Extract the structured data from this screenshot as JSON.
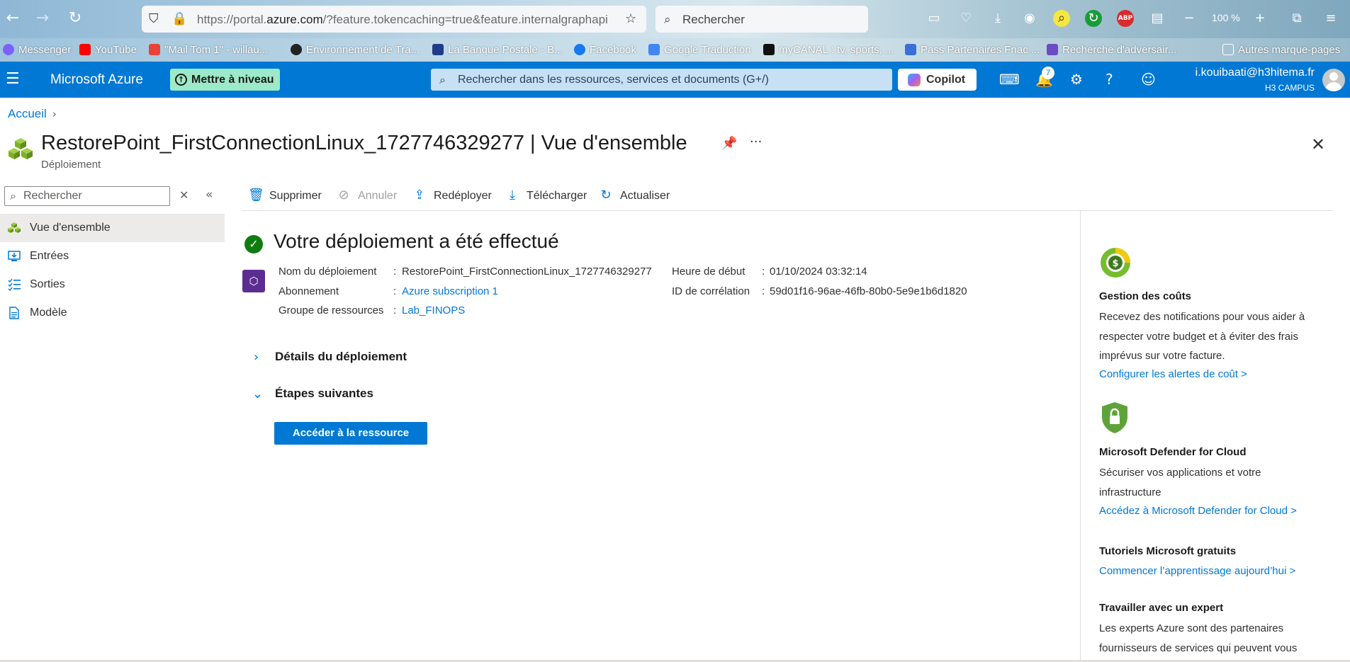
{
  "browser": {
    "url_prefix": "https://portal.",
    "url_domain": "azure.com",
    "url_rest": "/?feature.tokencaching=true&feature.internalgraphapi",
    "search_placeholder": "Rechercher",
    "zoom": "100 %",
    "bookmarks": [
      {
        "label": "Messenger",
        "color": "#7b61ff"
      },
      {
        "label": "YouTube",
        "color": "#ff0000"
      },
      {
        "label": "\"Mail Tom 1\" - willau...",
        "color": "#ea4335"
      },
      {
        "label": "Environnement de Tra...",
        "color": "#222222"
      },
      {
        "label": "La Banque Postale - B...",
        "color": "#1f3b8a"
      },
      {
        "label": "Facebook",
        "color": "#1877f2"
      },
      {
        "label": "Google Traduction",
        "color": "#4285f4"
      },
      {
        "label": "myCANAL : tv, sports, ...",
        "color": "#111111"
      },
      {
        "label": "Pass Partenaires Fnac ...",
        "color": "#3a6fd8"
      },
      {
        "label": "Recherche d'adversair...",
        "color": "#6a4cc5"
      },
      {
        "label": "Autres marque-pages",
        "color": "#ffffff"
      }
    ]
  },
  "header": {
    "brand": "Microsoft Azure",
    "upgrade_label": "Mettre à niveau",
    "search_placeholder": "Rechercher dans les ressources, services et documents (G+/)",
    "copilot_label": "Copilot",
    "notification_count": "7",
    "user_email": "i.kouibaati@h3hitema.fr",
    "user_org": "H3 CAMPUS"
  },
  "breadcrumb": {
    "home": "Accueil"
  },
  "page": {
    "title": "RestorePoint_FirstConnectionLinux_1727746329277 | Vue d'ensemble",
    "subtitle": "Déploiement"
  },
  "sidebar": {
    "search_placeholder": "Rechercher",
    "items": [
      {
        "label": "Vue d'ensemble",
        "active": true
      },
      {
        "label": "Entrées"
      },
      {
        "label": "Sorties"
      },
      {
        "label": "Modèle"
      }
    ]
  },
  "toolbar": {
    "delete": "Supprimer",
    "cancel": "Annuler",
    "redeploy": "Redéployer",
    "download": "Télécharger",
    "refresh": "Actualiser"
  },
  "main": {
    "heading": "Votre déploiement a été effectué",
    "fields": {
      "deployment_name_label": "Nom du déploiement",
      "deployment_name": "RestorePoint_FirstConnectionLinux_1727746329277",
      "subscription_label": "Abonnement",
      "subscription": "Azure subscription 1",
      "resource_group_label": "Groupe de ressources",
      "resource_group": "Lab_FINOPS",
      "start_time_label": "Heure de début",
      "start_time": "01/10/2024 03:32:14",
      "correlation_id_label": "ID de corrélation",
      "correlation_id": "59d01f16-96ae-46fb-80b0-5e9e1b6d1820"
    },
    "deployment_details": "Détails du déploiement",
    "next_steps": "Étapes suivantes",
    "go_to_resource": "Accéder à la ressource"
  },
  "right_panel": {
    "cost_title": "Gestion des coûts",
    "cost_text": "Recevez des notifications pour vous aider à respecter votre budget et à éviter des frais imprévus sur votre facture.",
    "cost_link": "Configurer les alertes de coût >",
    "defender_title": "Microsoft Defender for Cloud",
    "defender_text": "Sécuriser vos applications et votre infrastructure",
    "defender_link": "Accédez à Microsoft Defender for Cloud >",
    "tutorials_title": "Tutoriels Microsoft gratuits",
    "tutorials_link": "Commencer l’apprentissage aujourd’hui >",
    "expert_title": "Travailler avec un expert",
    "expert_text": "Les experts Azure sont des partenaires fournisseurs de services qui peuvent vous"
  }
}
